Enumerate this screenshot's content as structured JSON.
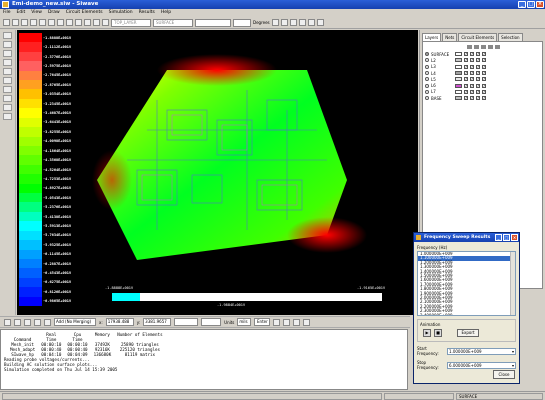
{
  "window": {
    "title": "Emi-demo_new.siw - Siwave"
  },
  "menu": [
    "File",
    "Edit",
    "View",
    "Draw",
    "Circuit Elements",
    "Simulation",
    "Results",
    "Help"
  ],
  "toolbar": {
    "layer_select": "TOP_LAYER",
    "net_select": "SURFACE",
    "zoom_unit": "Degrees"
  },
  "colorbar": {
    "labels": [
      "-1.8888E+001V",
      "-2.1112E+001V",
      "-2.3776E+001V",
      "-2.5975E+001V",
      "-2.7645E+001V",
      "-2.8765E+001V",
      "-3.0354E+001V",
      "-3.2345E+001V",
      "-3.4687E+001V",
      "-3.6443E+001V",
      "-3.8255E+001V",
      "-4.0098E+001V",
      "-4.1864E+001V",
      "-4.3568E+001V",
      "-4.5264E+001V",
      "-4.7253E+001V",
      "-4.8927E+001V",
      "-5.0543E+001V",
      "-5.2376E+001V",
      "-5.4138E+001V",
      "-5.5913E+001V",
      "-5.7634E+001V",
      "-5.9325E+001V",
      "-6.1145E+001V",
      "-6.2887E+001V",
      "-6.4543E+001V",
      "-6.6275E+001V",
      "-6.8126E+001V",
      "-6.9865E+001V"
    ],
    "colors": [
      "#ff0000",
      "#ff2020",
      "#ff4040",
      "#ff6060",
      "#ff8040",
      "#ffa020",
      "#ffc000",
      "#ffe000",
      "#ffff00",
      "#e0ff00",
      "#c0ff00",
      "#a0ff00",
      "#80ff00",
      "#60ff00",
      "#40ff00",
      "#20ff00",
      "#00ff00",
      "#00ff40",
      "#00ff80",
      "#00ffc0",
      "#00ffff",
      "#00e0ff",
      "#00c0ff",
      "#00a0ff",
      "#0080ff",
      "#0060ff",
      "#0040ff",
      "#0020ff",
      "#0000ff"
    ]
  },
  "bottom_scale": {
    "left": "-1.8888E+001V",
    "center": "-1.9884E+001V",
    "right": "-1.9165E+001V"
  },
  "layers_panel": {
    "tabs": [
      "Layers",
      "Nets",
      "Circuit Elements",
      "Selection"
    ],
    "layers": [
      {
        "name": "SURFACE",
        "color": "#ffffff",
        "selected": true
      },
      {
        "name": "L2",
        "color": "#c8c8c8",
        "selected": false
      },
      {
        "name": "L3",
        "color": "#ffffff",
        "selected": false
      },
      {
        "name": "L4",
        "color": "#a0a0a0",
        "selected": false
      },
      {
        "name": "L5",
        "color": "#e8e8e8",
        "selected": false
      },
      {
        "name": "L6",
        "color": "#d050d0",
        "selected": false
      },
      {
        "name": "L7",
        "color": "#ffffff",
        "selected": false
      },
      {
        "name": "BASE",
        "color": "#c0c0c0",
        "selected": false
      }
    ]
  },
  "controls": {
    "probe_select": "Add (No Merging)",
    "x": "17938.488",
    "y": "3381.9657",
    "units": "mils",
    "enter": "Enter"
  },
  "console": {
    "headers": [
      [
        "Command",
        "Real Time"
      ],
      [
        "Cpu",
        "Time"
      ],
      [
        "Memory",
        ""
      ],
      [
        "Number of Elements",
        ""
      ]
    ],
    "rows": [
      [
        "Mesh_init",
        "00:00:10",
        "00:00:10",
        "37492K",
        "25890 triangles"
      ],
      [
        "Mesh_adapt",
        "00:00:40",
        "00:00:40",
        "92316K",
        "225120 triangles"
      ],
      [
        "SIwave_hp",
        "00:04:10",
        "00:04:09",
        "136680K",
        "81119 matrix"
      ]
    ],
    "lines": [
      "Reading probe voltages/currents...",
      "Building AC solution surface plots...",
      "Simulation completed on Thu Jul 14 15:39 2005"
    ]
  },
  "dialog": {
    "title": "Frequency Sweep Results",
    "freq_label": "Frequency (Hz)",
    "frequencies": [
      "1.000000E+009",
      "1.100000E+009",
      "1.200000E+009",
      "1.300000E+009",
      "1.400000E+009",
      "1.500000E+009",
      "1.600000E+009",
      "1.700000E+009",
      "1.800000E+009",
      "1.900000E+009",
      "2.000000E+009",
      "2.100000E+009",
      "2.200000E+009",
      "2.300000E+009",
      "2.400000E+009"
    ],
    "selected_index": 1,
    "animation_label": "Animation",
    "export_label": "Export",
    "start_label": "Start Frequency:",
    "start_value": "1.000000E+009",
    "stop_label": "Stop Frequency:",
    "stop_value": "6.000000E+009",
    "close_label": "Close"
  },
  "status": {
    "right": "SURFACE"
  }
}
